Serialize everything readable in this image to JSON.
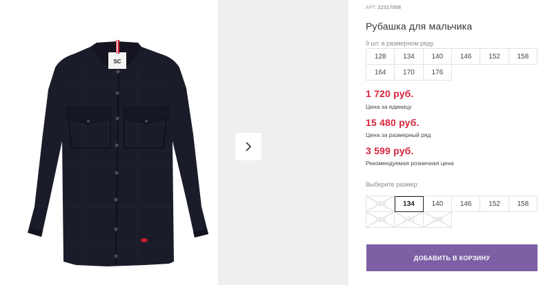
{
  "product": {
    "article_label": "АРТ.",
    "article_number": "22317058",
    "title": "Рубашка для мальчика",
    "pack_note": "9 шт. в размерном ряду",
    "pack_sizes": [
      "128",
      "134",
      "140",
      "146",
      "152",
      "158",
      "164",
      "170",
      "176"
    ]
  },
  "prices": [
    {
      "value": "1 720 руб.",
      "caption": "Цена за единицу"
    },
    {
      "value": "15 480 руб.",
      "caption": "Цена за размерный ряд"
    },
    {
      "value": "3 599 руб.",
      "caption": "Рекомендуемая розничная цена"
    }
  ],
  "size_picker": {
    "label": "Выберите размер:",
    "sizes": [
      {
        "label": "128",
        "available": false,
        "selected": false
      },
      {
        "label": "134",
        "available": true,
        "selected": true
      },
      {
        "label": "140",
        "available": true,
        "selected": false
      },
      {
        "label": "146",
        "available": true,
        "selected": false
      },
      {
        "label": "152",
        "available": true,
        "selected": false
      },
      {
        "label": "158",
        "available": true,
        "selected": false
      },
      {
        "label": "164",
        "available": false,
        "selected": false
      },
      {
        "label": "170",
        "available": false,
        "selected": false
      },
      {
        "label": "176",
        "available": false,
        "selected": false
      }
    ]
  },
  "shirt_logo_text": "SC",
  "add_to_cart_label": "ДОБАВИТЬ В КОРЗИНУ",
  "colors": {
    "price_red": "#d6233b",
    "button_purple": "#7c5fa4",
    "shirt_navy": "#1b1c2a"
  }
}
